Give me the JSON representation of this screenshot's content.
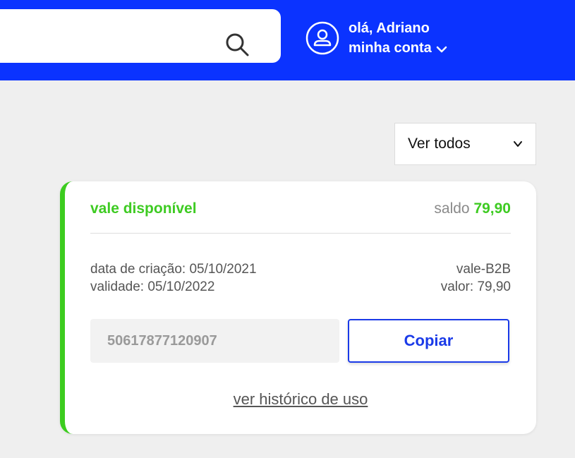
{
  "header": {
    "search": {
      "icon": "search-icon"
    },
    "user": {
      "icon": "user-icon",
      "greeting": "olá, Adriano",
      "account_label": "minha conta",
      "account_icon": "chevron-down-icon"
    },
    "background": "#0b33ff"
  },
  "filter": {
    "selected": "Ver todos",
    "icon": "chevron-down-icon"
  },
  "voucher": {
    "status": "vale disponível",
    "balance_label": "saldo",
    "balance_value": "79,90",
    "created": "data de criação: 05/10/2021",
    "validity": "validade: 05/10/2022",
    "type": "vale-B2B",
    "value": "valor: 79,90",
    "code": "50617877120907",
    "copy_label": "Copiar",
    "history_link": "ver histórico de uso",
    "accent_color": "#3ecb22",
    "button_color": "#1a3ae8"
  }
}
